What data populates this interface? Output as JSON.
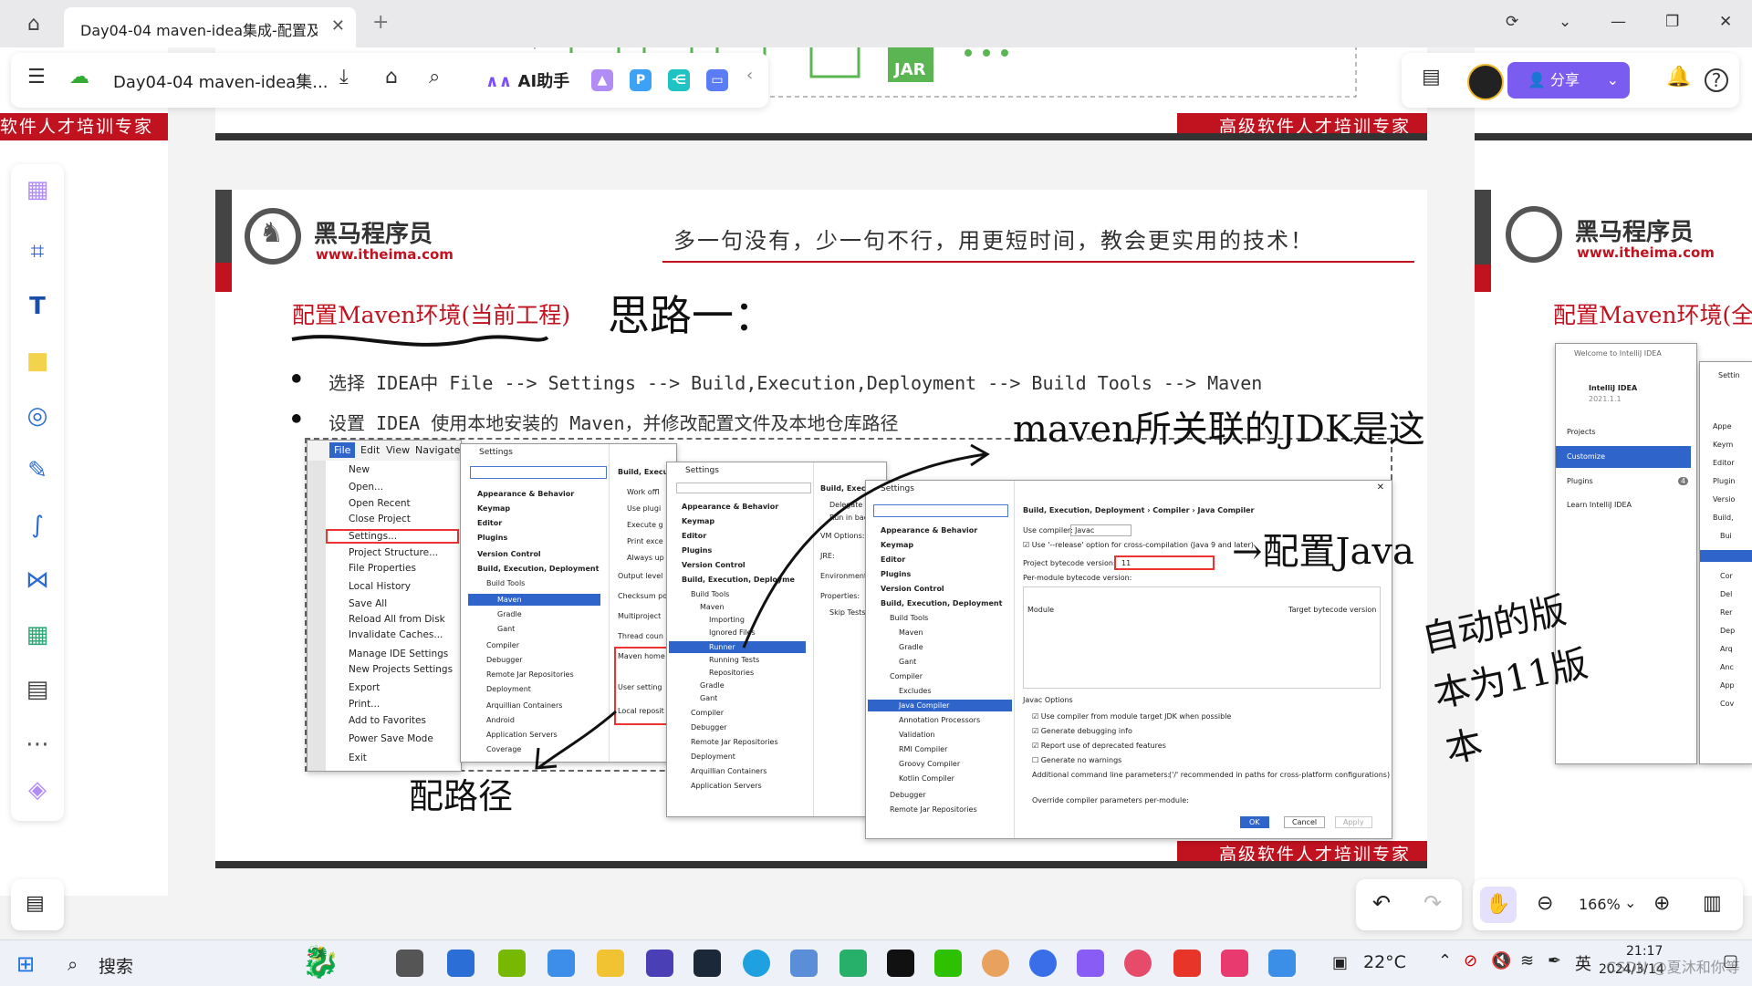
{
  "browser": {
    "tab_title": "Day04-04 maven-idea集成-配置及创建",
    "new_tab": "+",
    "close": "✕"
  },
  "toolbar": {
    "doc_title": "Day04-04 maven-idea集...",
    "ai_label": "AI助手",
    "share_label": "分享"
  },
  "slide": {
    "banner": "高级软件人才培训专家",
    "left_banner": "软件人才培训专家",
    "brand": "黑马程序员",
    "brand_url": "www.itheima.com",
    "slogan": "多一句没有，少一句不行，用更短时间，教会更实用的技术！",
    "heading": "配置Maven环境(当前工程)",
    "right_heading": "配置Maven环境(全",
    "bullet1": "选择 IDEA中 File --> Settings --> Build,Execution,Deployment --> Build Tools --> Maven",
    "bullet2": "设置 IDEA 使用本地安装的 Maven，并修改配置文件及本地仓库路径"
  },
  "handwriting": {
    "idea": "思路一：",
    "maven_jdk": "maven所关联的JDK是这",
    "config_java": "→配置Java",
    "config_path": "配路径",
    "versions": "自动的版本为11版本"
  },
  "idea_menu": {
    "tabs": [
      "File",
      "Edit",
      "View",
      "Navigate"
    ],
    "items": [
      "New",
      "Open...",
      "Open Recent",
      "Close Project",
      "Settings...",
      "Project Structure...",
      "File Properties",
      "Local History",
      "Save All",
      "Reload All from Disk",
      "Invalidate Caches...",
      "Manage IDE Settings",
      "New Projects Settings",
      "Export",
      "Print...",
      "Add to Favorites",
      "Power Save Mode",
      "Exit"
    ]
  },
  "settings1": {
    "title": "Settings",
    "tree": [
      "Appearance & Behavior",
      "Keymap",
      "Editor",
      "Plugins",
      "Version Control",
      "Build, Execution, Deployment",
      "Build Tools",
      "Maven",
      "Gradle",
      "Gant",
      "Compiler",
      "Debugger",
      "Remote Jar Repositories",
      "Deployment",
      "Arquillian Containers",
      "Android",
      "Application Servers",
      "Coverage"
    ],
    "right": [
      "Build, Execut",
      "Work offl",
      "Use plugi",
      "Execute g",
      "Print exce",
      "Always up",
      "Output level",
      "Checksum po",
      "Multiproject",
      "Thread coun",
      "Maven home",
      "User setting",
      "Local reposit"
    ]
  },
  "settings2": {
    "title": "Settings",
    "tree": [
      "Appearance & Behavior",
      "Keymap",
      "Editor",
      "Plugins",
      "Version Control",
      "Build, Execution, Deployme",
      "Build Tools",
      "Maven",
      "Importing",
      "Ignored Files",
      "Runner",
      "Running Tests",
      "Repositories",
      "Gradle",
      "Gant",
      "Compiler",
      "Debugger",
      "Remote Jar Repositories",
      "Deployment",
      "Arquillian Containers",
      "Application Servers"
    ],
    "right": [
      "Build, Execution",
      "Delegate",
      "Run in backg",
      "VM Options:",
      "JRE:",
      "Environment va",
      "Properties:",
      "Skip Tests"
    ]
  },
  "settings3": {
    "title": "Settings",
    "breadcrumb": "Build, Execution, Deployment › Compiler › Java Compiler",
    "use_compiler_label": "Use compiler:",
    "use_compiler_value": "Javac",
    "release_option": "Use '--release' option for cross-compilation (Java 9 and later)",
    "bytecode_label": "Project bytecode version:",
    "bytecode_value": "11",
    "per_module": "Per-module bytecode version:",
    "col_module": "Module",
    "col_target": "Target bytecode version",
    "javac_options": "Javac Options",
    "opt1": "Use compiler from module target JDK when possible",
    "opt2": "Generate debugging info",
    "opt3": "Report use of deprecated features",
    "opt4": "Generate no warnings",
    "additional": "Additional command line parameters:",
    "additional_hint": "('/' recommended in paths for cross-platform configurations)",
    "override": "Override compiler parameters per-module:",
    "ok": "OK",
    "cancel": "Cancel",
    "apply": "Apply",
    "tree": [
      "Appearance & Behavior",
      "Keymap",
      "Editor",
      "Plugins",
      "Version Control",
      "Build, Execution, Deployment",
      "Build Tools",
      "Maven",
      "Gradle",
      "Gant",
      "Compiler",
      "Excludes",
      "Java Compiler",
      "Annotation Processors",
      "Validation",
      "RMI Compiler",
      "Groovy Compiler",
      "Kotlin Compiler",
      "Debugger",
      "Remote Jar Repositories"
    ]
  },
  "welcome": {
    "title": "Welcome to IntelliJ IDEA",
    "app": "IntelliJ IDEA",
    "version": "2021.1.1",
    "items": [
      "Projects",
      "Customize",
      "Plugins",
      "Learn IntelliJ IDEA"
    ],
    "badge": "4",
    "settings_title": "Settin",
    "settings_items": [
      "Appe",
      "Keym",
      "Editor",
      "Plugin",
      "Versio",
      "Build,",
      "Bui",
      "",
      "Cor",
      "Del",
      "Rer",
      "Dep",
      "Arq",
      "Anc",
      "App",
      "Cov"
    ]
  },
  "bottom": {
    "zoom": "166%"
  },
  "taskbar": {
    "search": "搜索",
    "temp": "22°C",
    "lang": "英",
    "time": "21:17",
    "date": "2024/3/14",
    "watermark": "CSDN @夏沐和你等"
  },
  "jar_label": "JAR"
}
